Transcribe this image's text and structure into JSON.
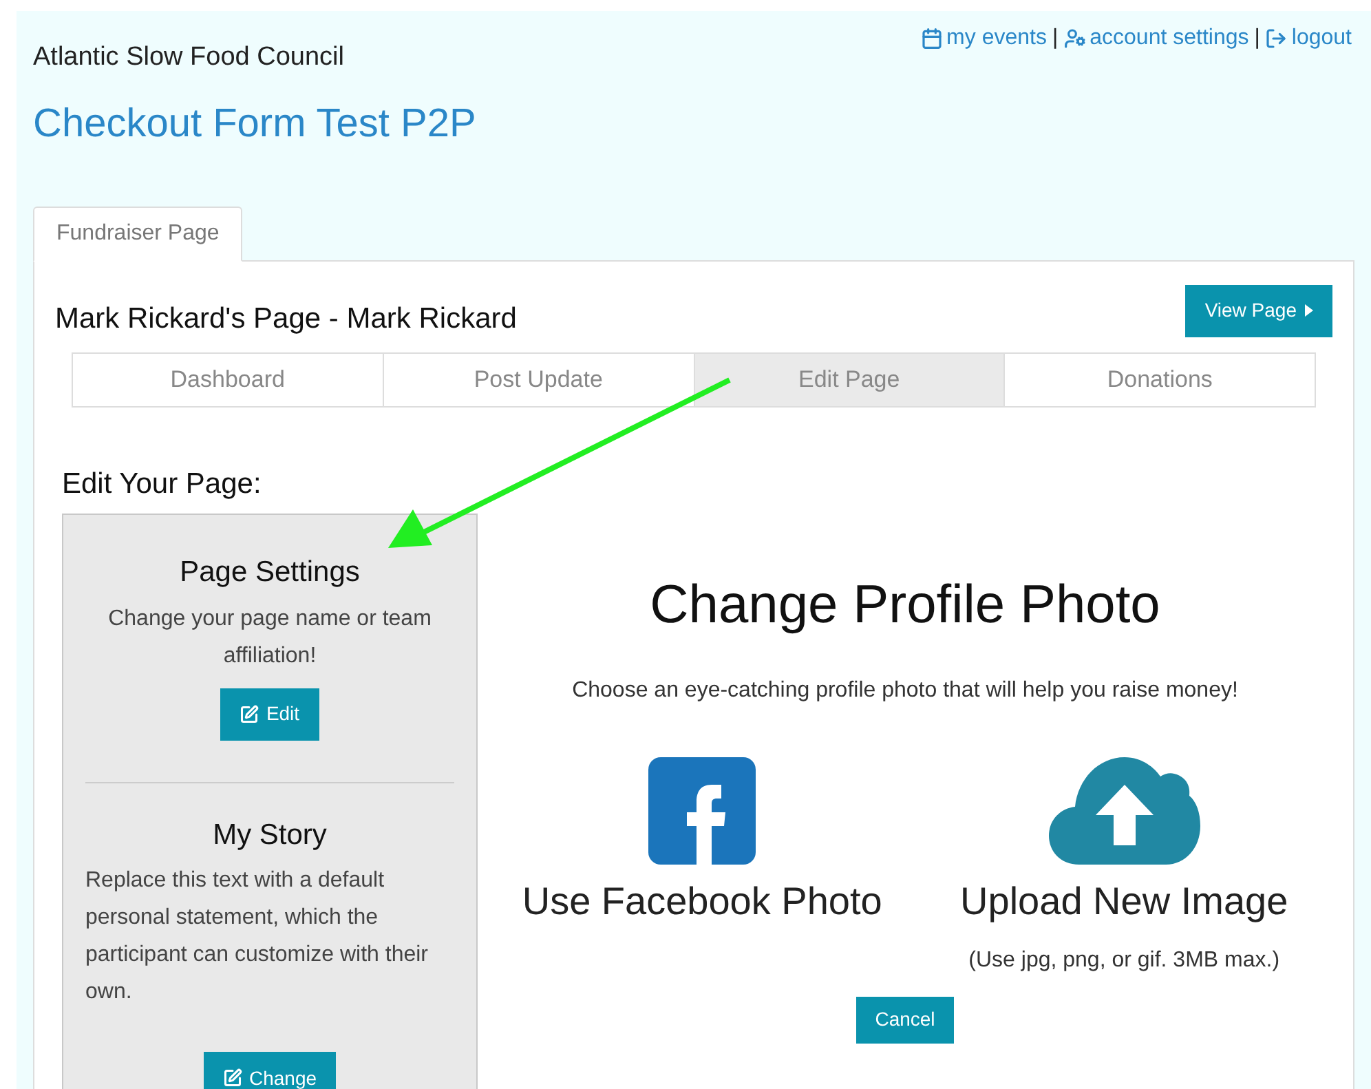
{
  "header": {
    "organization": "Atlantic Slow Food Council",
    "title": "Checkout Form Test P2P",
    "links": [
      {
        "label": "my events"
      },
      {
        "label": "account settings"
      },
      {
        "label": "logout"
      }
    ],
    "separator": "|"
  },
  "page_tab": {
    "label": "Fundraiser Page",
    "selected": true
  },
  "page_heading": "Mark Rickard's Page - Mark Rickard",
  "view_button": "View Page",
  "nav_tabs": [
    {
      "label": "Dashboard",
      "selected": false
    },
    {
      "label": "Post Update",
      "selected": false
    },
    {
      "label": "Edit Page",
      "selected": true
    },
    {
      "label": "Donations",
      "selected": false
    }
  ],
  "edit_heading": "Edit Your Page:",
  "sections": [
    {
      "kind": "centered",
      "title": "Page Settings",
      "text": "Change your page name or team affiliation!",
      "button": "Edit"
    },
    {
      "kind": "left",
      "title": "My Story",
      "text": "Replace this text with a default personal statement, which the participant can customize with their own.",
      "button": "Change"
    }
  ],
  "photo": {
    "title": "Change Profile Photo",
    "subtitle": "Choose an eye-catching profile photo that will help you raise money!",
    "options": [
      {
        "kind": "facebook",
        "label": "Use Facebook Photo"
      },
      {
        "kind": "upload",
        "label": "Upload New Image",
        "note": "(Use jpg, png, or gif. 3MB max.)"
      }
    ],
    "cancel": "Cancel"
  }
}
